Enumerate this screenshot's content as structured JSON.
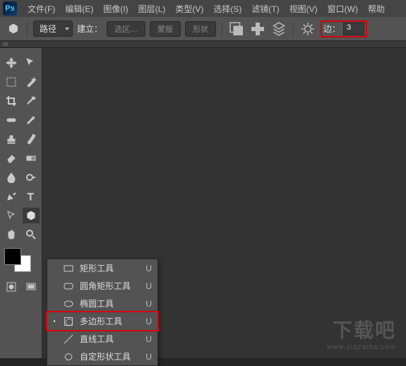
{
  "menubar": {
    "items": [
      "文件(F)",
      "编辑(E)",
      "图像(I)",
      "图层(L)",
      "类型(V)",
      "选择(S)",
      "滤镜(T)",
      "视图(V)",
      "窗口(W)",
      "帮助"
    ]
  },
  "optbar": {
    "mode": "路径",
    "build_label": "建立：",
    "btn_selection": "选区…",
    "btn_mask": "蒙版",
    "btn_shape": "形状",
    "sides_label": "边：",
    "sides_value": "3"
  },
  "flyout": {
    "items": [
      {
        "label": "矩形工具",
        "shortcut": "U",
        "checked": false,
        "icon": "rect"
      },
      {
        "label": "圆角矩形工具",
        "shortcut": "U",
        "checked": false,
        "icon": "rrect"
      },
      {
        "label": "椭圆工具",
        "shortcut": "U",
        "checked": false,
        "icon": "ellipse"
      },
      {
        "label": "多边形工具",
        "shortcut": "U",
        "checked": true,
        "icon": "polygon"
      },
      {
        "label": "直线工具",
        "shortcut": "U",
        "checked": false,
        "icon": "line"
      },
      {
        "label": "自定形状工具",
        "shortcut": "U",
        "checked": false,
        "icon": "custom"
      }
    ]
  },
  "watermark": {
    "main": "下载吧",
    "sub": "www.xiazaiba.com"
  }
}
